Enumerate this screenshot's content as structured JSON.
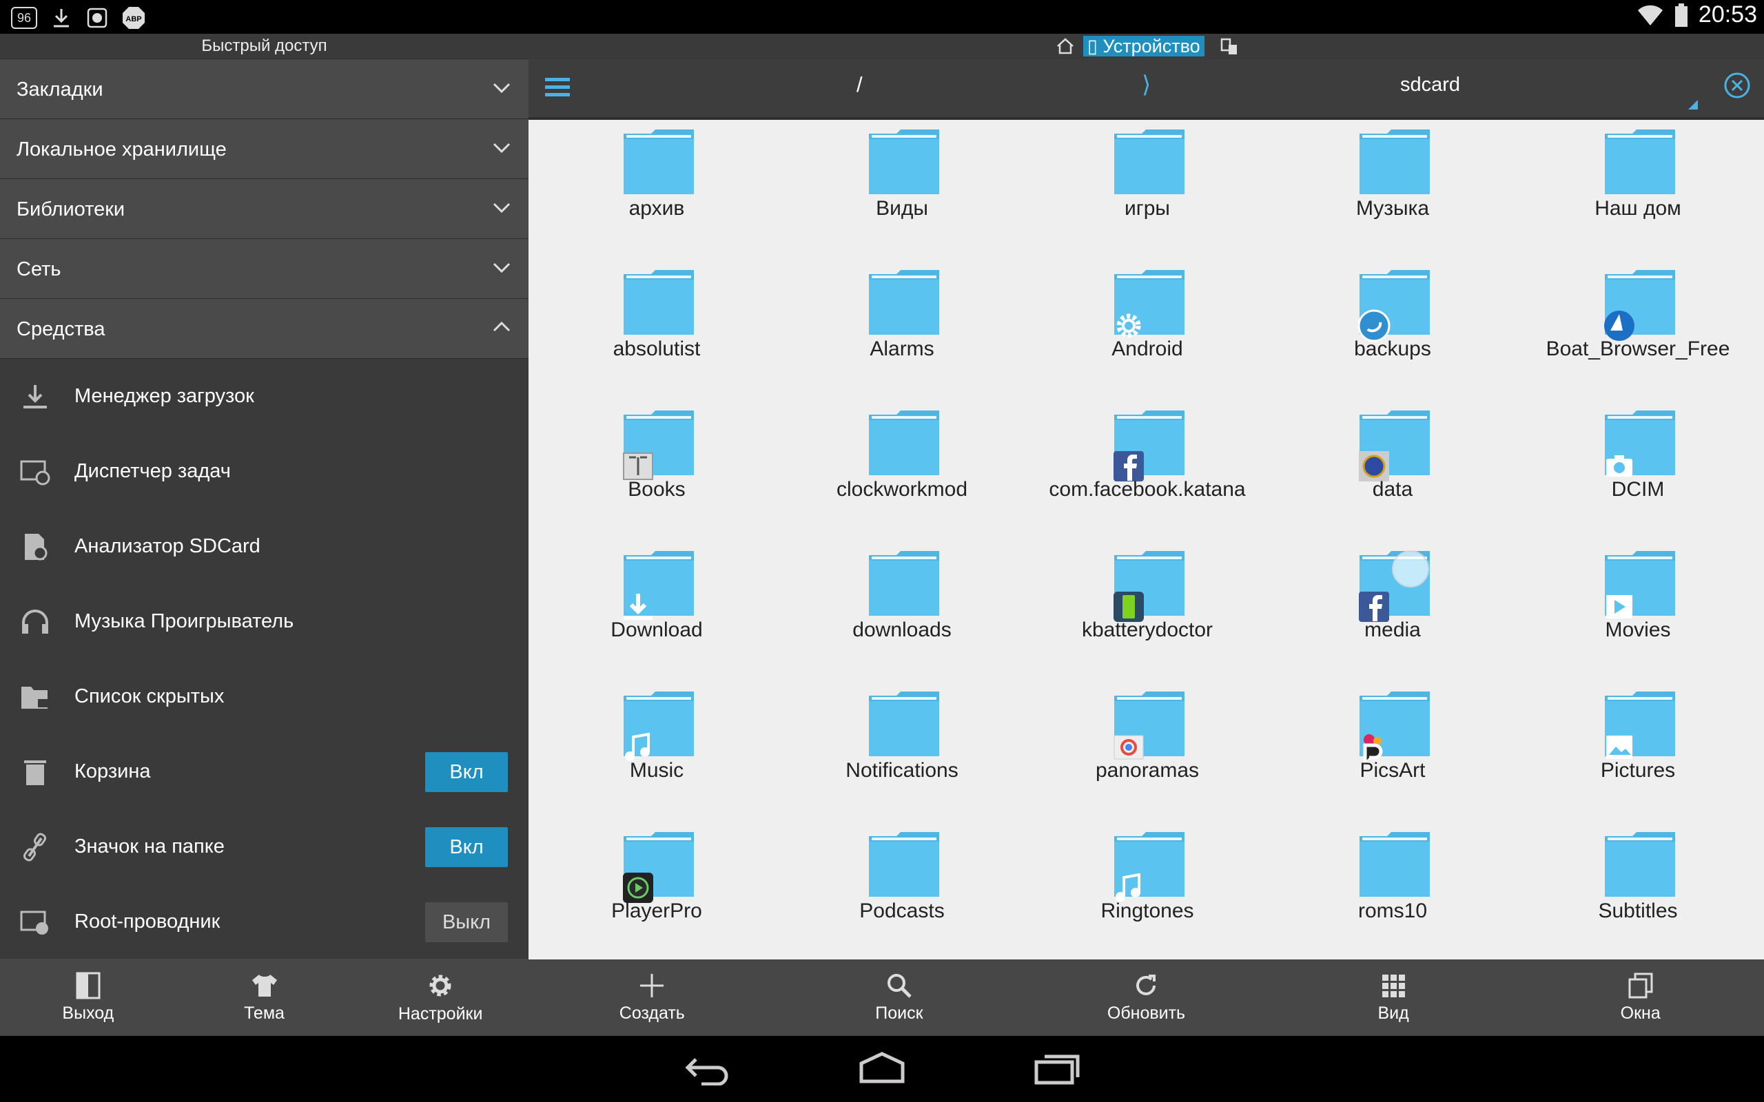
{
  "status_bar": {
    "notification_icons": [
      "96-badge-icon",
      "download-icon",
      "android-icon",
      "abp-icon"
    ],
    "icon_texts": [
      "96",
      "ABP"
    ],
    "time": "20:53"
  },
  "left_panel": {
    "title": "Быстрый доступ",
    "sections": [
      {
        "label": "Закладки",
        "expanded": false
      },
      {
        "label": "Локальное хранилище",
        "expanded": false
      },
      {
        "label": "Библиотеки",
        "expanded": false
      },
      {
        "label": "Сеть",
        "expanded": false
      },
      {
        "label": "Средства",
        "expanded": true
      }
    ],
    "tools": [
      {
        "label": "Менеджер загрузок",
        "icon": "download-icon"
      },
      {
        "label": "Диспетчер задач",
        "icon": "task-manager-icon"
      },
      {
        "label": "Анализатор SDCard",
        "icon": "sd-card-icon"
      },
      {
        "label": "Музыка Проигрыватель",
        "icon": "headphones-icon"
      },
      {
        "label": "Список скрытых",
        "icon": "hidden-folder-icon"
      },
      {
        "label": "Корзина",
        "icon": "trash-icon",
        "toggle": "Вкл"
      },
      {
        "label": "Значок на папке",
        "icon": "link-icon",
        "toggle": "Вкл"
      },
      {
        "label": "Root-проводник",
        "icon": "root-explorer-icon",
        "toggle": "Выкл"
      }
    ],
    "bottom_buttons": [
      {
        "label": "Выход",
        "icon": "exit-icon"
      },
      {
        "label": "Тема",
        "icon": "shirt-icon"
      },
      {
        "label": "Настройки",
        "icon": "gear-icon"
      }
    ]
  },
  "right_panel": {
    "device_tab": "Устройство",
    "path_root": "/",
    "path_separator": "⟩",
    "path_current": "sdcard",
    "files": [
      {
        "name": "архив",
        "badge": null
      },
      {
        "name": "Виды",
        "badge": null
      },
      {
        "name": "игры",
        "badge": null
      },
      {
        "name": "Музыка",
        "badge": null
      },
      {
        "name": "Наш дом",
        "badge": null
      },
      {
        "name": "absolutist",
        "badge": null
      },
      {
        "name": "Alarms",
        "badge": null
      },
      {
        "name": "Android",
        "badge": "gear"
      },
      {
        "name": "backups",
        "badge": "es"
      },
      {
        "name": "Boat_Browser_Free",
        "badge": "boat"
      },
      {
        "name": "Books",
        "badge": "book"
      },
      {
        "name": "clockworkmod",
        "badge": null
      },
      {
        "name": "com.facebook.katana",
        "badge": "facebook"
      },
      {
        "name": "data",
        "badge": "seal"
      },
      {
        "name": "DCIM",
        "badge": "camera"
      },
      {
        "name": "Download",
        "badge": "download"
      },
      {
        "name": "downloads",
        "badge": null
      },
      {
        "name": "kbatterydoctor",
        "badge": "battery"
      },
      {
        "name": "media",
        "badge": "facebook"
      },
      {
        "name": "Movies",
        "badge": "play"
      },
      {
        "name": "Music",
        "badge": "note"
      },
      {
        "name": "Notifications",
        "badge": null
      },
      {
        "name": "panoramas",
        "badge": "panorama"
      },
      {
        "name": "PicsArt",
        "badge": "picsart"
      },
      {
        "name": "Pictures",
        "badge": "picture"
      },
      {
        "name": "PlayerPro",
        "badge": "playerpro"
      },
      {
        "name": "Podcasts",
        "badge": null
      },
      {
        "name": "Ringtones",
        "badge": "note"
      },
      {
        "name": "roms10",
        "badge": null
      },
      {
        "name": "Subtitles",
        "badge": null
      }
    ],
    "bottom_buttons": [
      {
        "label": "Создать",
        "icon": "plus-icon"
      },
      {
        "label": "Поиск",
        "icon": "search-icon"
      },
      {
        "label": "Обновить",
        "icon": "refresh-icon"
      },
      {
        "label": "Вид",
        "icon": "grid-view-icon"
      },
      {
        "label": "Окна",
        "icon": "windows-icon"
      }
    ]
  },
  "colors": {
    "accent": "#1f8fbf",
    "folder": "#5bc3ef",
    "panel_dark": "#3a3a3a",
    "content_bg": "#efefef"
  }
}
